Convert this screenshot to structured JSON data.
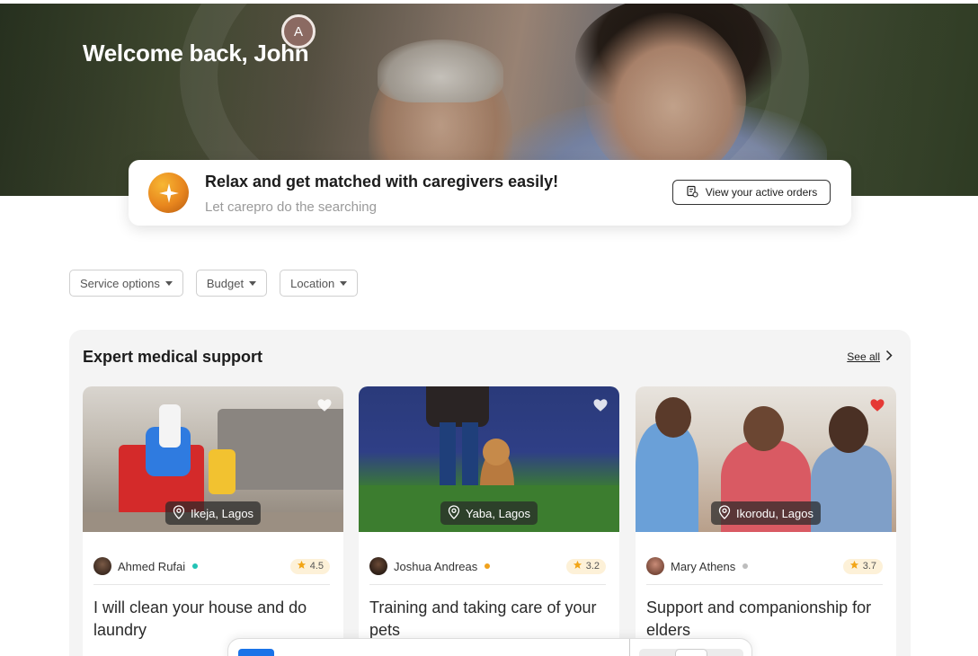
{
  "hero": {
    "welcome": "Welcome back, John",
    "avatar_initial": "A"
  },
  "match_card": {
    "title": "Relax and get matched with caregivers easily!",
    "subtitle": "Let carepro do the searching",
    "orders_button": "View your active orders"
  },
  "filters": [
    {
      "label": "Service options"
    },
    {
      "label": "Budget"
    },
    {
      "label": "Location"
    }
  ],
  "section": {
    "title": "Expert medical support",
    "see_all": "See all"
  },
  "cards": [
    {
      "location": "Ikeja, Lagos",
      "owner": "Ahmed Rufai",
      "rating": "4.5",
      "status_color": "#22c3b5",
      "favorited": false,
      "title": "I will clean your house and do laundry"
    },
    {
      "location": "Yaba, Lagos",
      "owner": "Joshua Andreas",
      "rating": "3.2",
      "status_color": "#f0a11c",
      "favorited": false,
      "title": "Training and taking care of your pets"
    },
    {
      "location": "Ikorodu, Lagos",
      "owner": "Mary Athens",
      "rating": "3.7",
      "status_color": "#bdbdbd",
      "favorited": true,
      "title": "Support and companionship for elders"
    }
  ],
  "colors": {
    "accent_orange": "#e8861e",
    "favorite_red": "#e53935",
    "rating_star": "#f2a516"
  }
}
